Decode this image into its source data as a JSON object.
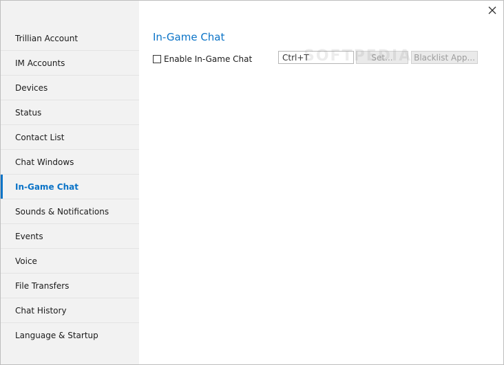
{
  "sidebar": {
    "items": [
      {
        "label": "Trillian Account",
        "active": false
      },
      {
        "label": "IM Accounts",
        "active": false
      },
      {
        "label": "Devices",
        "active": false
      },
      {
        "label": "Status",
        "active": false
      },
      {
        "label": "Contact List",
        "active": false
      },
      {
        "label": "Chat Windows",
        "active": false
      },
      {
        "label": "In-Game Chat",
        "active": true
      },
      {
        "label": "Sounds & Notifications",
        "active": false
      },
      {
        "label": "Events",
        "active": false
      },
      {
        "label": "Voice",
        "active": false
      },
      {
        "label": "File Transfers",
        "active": false
      },
      {
        "label": "Chat History",
        "active": false
      },
      {
        "label": "Language & Startup",
        "active": false
      }
    ]
  },
  "main": {
    "title": "In-Game Chat",
    "enable_checkbox": {
      "label": "Enable In-Game Chat",
      "checked": false
    },
    "hotkey": {
      "value": "Ctrl+T"
    },
    "set_button": "Set...",
    "blacklist_button": "Blacklist App...",
    "watermark": "SOFTPEDIA"
  },
  "colors": {
    "accent": "#0a73c7",
    "sidebar_bg": "#f2f2f2"
  },
  "icons": {
    "close": "close-icon"
  }
}
